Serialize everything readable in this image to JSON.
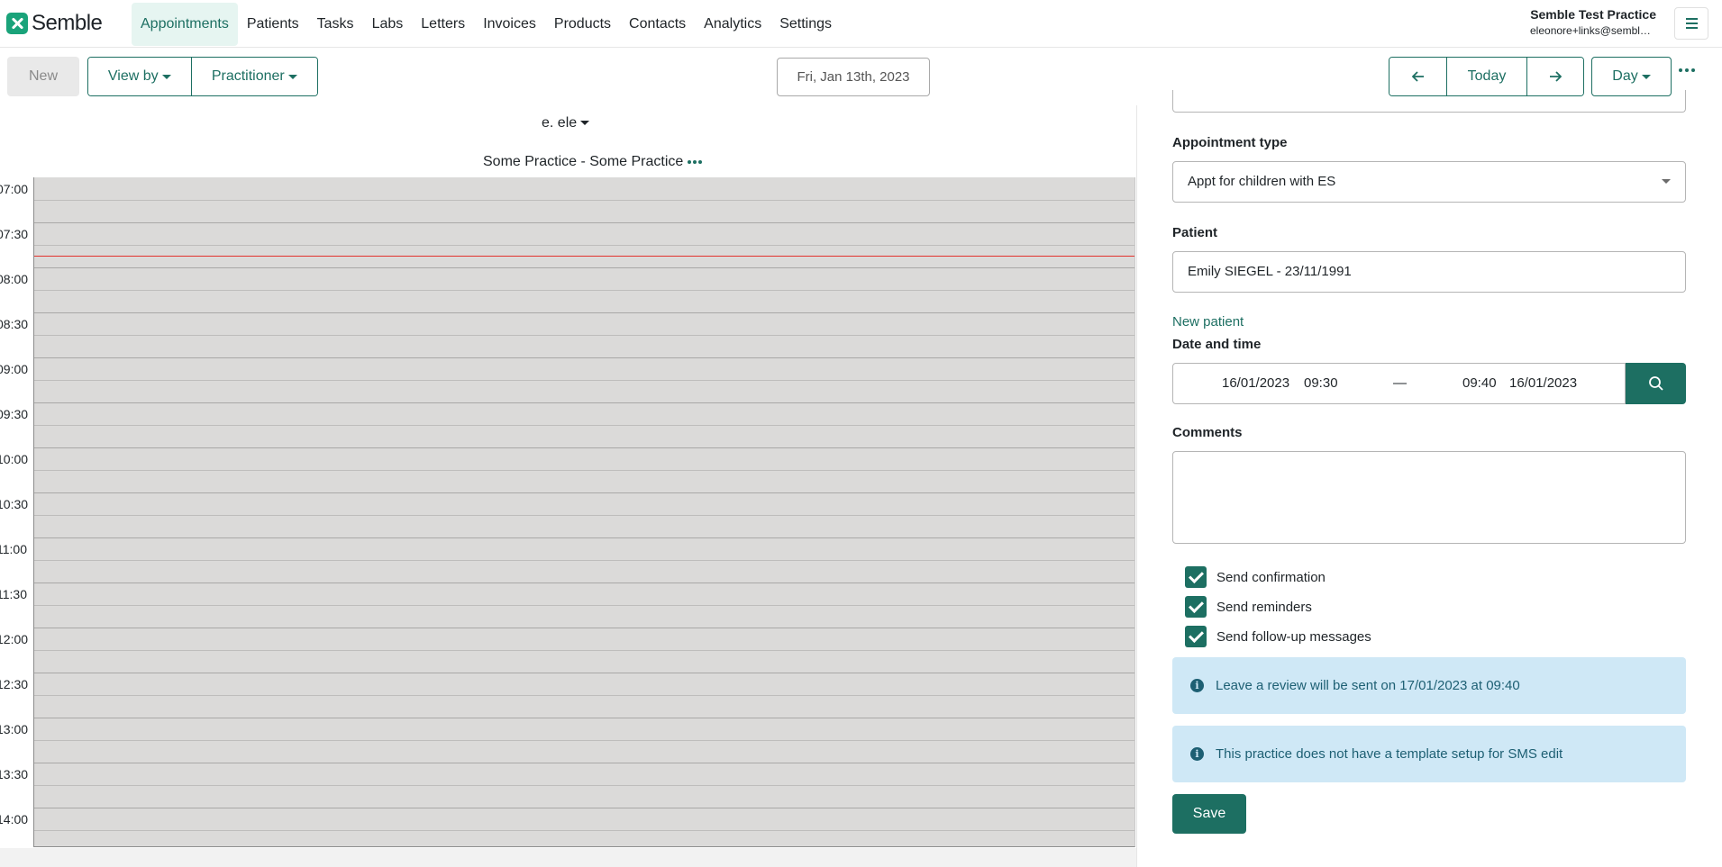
{
  "app": {
    "name": "Semble"
  },
  "nav": {
    "items": [
      {
        "label": "Appointments",
        "active": true
      },
      {
        "label": "Patients"
      },
      {
        "label": "Tasks"
      },
      {
        "label": "Labs"
      },
      {
        "label": "Letters"
      },
      {
        "label": "Invoices"
      },
      {
        "label": "Products"
      },
      {
        "label": "Contacts"
      },
      {
        "label": "Analytics"
      },
      {
        "label": "Settings"
      }
    ],
    "practice_name": "Semble Test Practice",
    "user_email": "eleonore+links@semble.io",
    "menu_icon": "hamburger-icon"
  },
  "toolbar": {
    "new_label": "New",
    "view_by_label": "View by",
    "practitioner_label": "Practitioner",
    "date_label": "Fri, Jan 13th, 2023",
    "prev_icon": "arrow-left-icon",
    "today_label": "Today",
    "next_icon": "arrow-right-icon",
    "view_mode_label": "Day",
    "more_icon": "more-dots-icon"
  },
  "calendar": {
    "practitioner": "e. ele",
    "practice": "Some Practice - Some Practice",
    "time_slots": [
      "07:00",
      "07:30",
      "08:00",
      "08:30",
      "09:00",
      "09:30",
      "10:00",
      "10:30",
      "11:00",
      "11:30",
      "12:00",
      "12:30",
      "13:00",
      "13:30",
      "14:00"
    ],
    "line_color": "#e2332e"
  },
  "form": {
    "appointment_type_label": "Appointment type",
    "appointment_type_value": "Appt for children with ES",
    "patient_label": "Patient",
    "patient_value": "Emily SIEGEL - 23/11/1991",
    "new_patient_link": "New patient",
    "datetime_label": "Date and time",
    "start_date": "16/01/2023",
    "start_time": "09:30",
    "separator": "—",
    "end_time": "09:40",
    "end_date": "16/01/2023",
    "search_icon": "search-icon",
    "comments_label": "Comments",
    "comments_value": "",
    "checks": [
      {
        "label": "Send confirmation",
        "checked": true
      },
      {
        "label": "Send reminders",
        "checked": true
      },
      {
        "label": "Send follow-up messages",
        "checked": true
      }
    ],
    "alerts": [
      {
        "text": "Leave a review will be sent on 17/01/2023 at 09:40"
      },
      {
        "text": "This practice does not have a template setup for SMS edit"
      }
    ],
    "save_label": "Save"
  },
  "colors": {
    "brand": "#1d6f62",
    "alert_bg": "#cfe8f6",
    "calendar_bg": "#dbdad9"
  }
}
